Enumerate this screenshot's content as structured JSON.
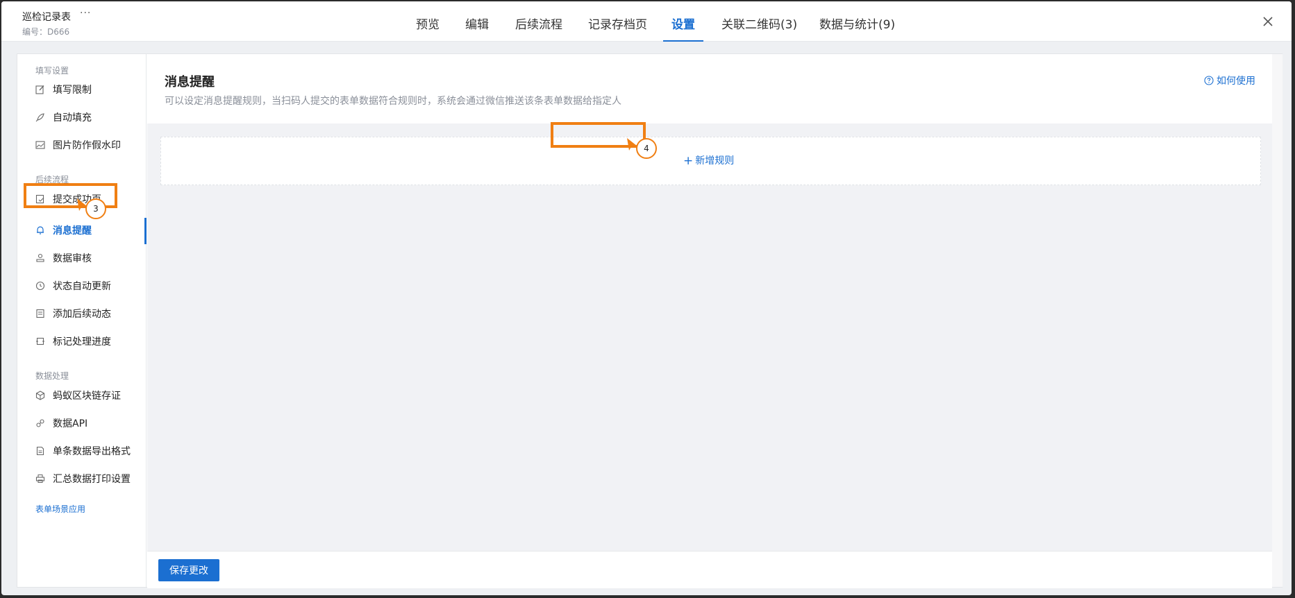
{
  "header": {
    "doc_title": "巡检记录表",
    "more_label": "···",
    "doc_id": "编号：D666"
  },
  "tabs": [
    {
      "label": "预览"
    },
    {
      "label": "编辑"
    },
    {
      "label": "后续流程"
    },
    {
      "label": "记录存档页"
    },
    {
      "label": "设置",
      "active": true
    },
    {
      "label": "关联二维码(3)"
    },
    {
      "label": "数据与统计(9)"
    }
  ],
  "sidebar": {
    "section_fill": "填写设置",
    "fill_items": [
      {
        "label": "填写限制",
        "icon": "edit-icon"
      },
      {
        "label": "自动填充",
        "icon": "rocket-icon"
      },
      {
        "label": "图片防作假水印",
        "icon": "image-icon"
      }
    ],
    "section_flow": "后续流程",
    "flow_items": [
      {
        "label": "提交成功页",
        "icon": "check-doc-icon"
      },
      {
        "label": "消息提醒",
        "icon": "bell-icon",
        "active": true
      },
      {
        "label": "数据审核",
        "icon": "stamp-icon"
      },
      {
        "label": "状态自动更新",
        "icon": "clock-icon"
      },
      {
        "label": "添加后续动态",
        "icon": "list-doc-icon"
      },
      {
        "label": "标记处理进度",
        "icon": "progress-icon"
      }
    ],
    "section_data": "数据处理",
    "data_items": [
      {
        "label": "蚂蚁区块链存证",
        "icon": "cube-icon"
      },
      {
        "label": "数据API",
        "icon": "link-icon"
      },
      {
        "label": "单条数据导出格式",
        "icon": "file-icon"
      },
      {
        "label": "汇总数据打印设置",
        "icon": "printer-icon"
      }
    ],
    "scene_link": "表单场景应用"
  },
  "main": {
    "title": "消息提醒",
    "description": "可以设定消息提醒规则，当扫码人提交的表单数据符合规则时，系统会通过微信推送该条表单数据给指定人",
    "help_link": "如何使用",
    "add_rule": "新增规则",
    "save_button": "保存更改"
  },
  "annotations": {
    "step_3": "3",
    "step_4": "4"
  },
  "colors": {
    "accent": "#1b6fd1",
    "annotation": "#f07f13"
  }
}
